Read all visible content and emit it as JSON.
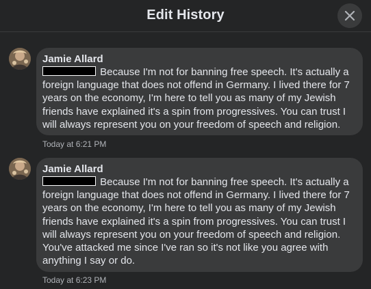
{
  "header": {
    "title": "Edit History",
    "close_icon": "close-icon"
  },
  "entries": [
    {
      "author": "Jamie Allard",
      "redacted": true,
      "message": "Because I'm not for banning free speech. It's actually a foreign language that does not offend in Germany. I lived there for 7 years on the economy, I'm here to tell you as many of my Jewish friends have explained it's a spin from progressives. You can trust I will always represent you on your freedom of speech and religion.",
      "timestamp": "Today at 6:21 PM"
    },
    {
      "author": "Jamie Allard",
      "redacted": true,
      "message": "Because I'm not for banning free speech. It's actually a foreign language that does not offend in Germany. I lived there for 7 years on the economy, I'm here to tell you as many of my Jewish friends have explained it's a spin from progressives. You can trust I will always represent you on your freedom of speech and religion. You've attacked me since I've ran so it's not like you agree with anything I say or do.",
      "timestamp": "Today at 6:23 PM"
    }
  ],
  "colors": {
    "background": "#242526",
    "bubble": "#3a3b3c",
    "text_primary": "#e4e6eb",
    "text_secondary": "#b0b3b8"
  }
}
